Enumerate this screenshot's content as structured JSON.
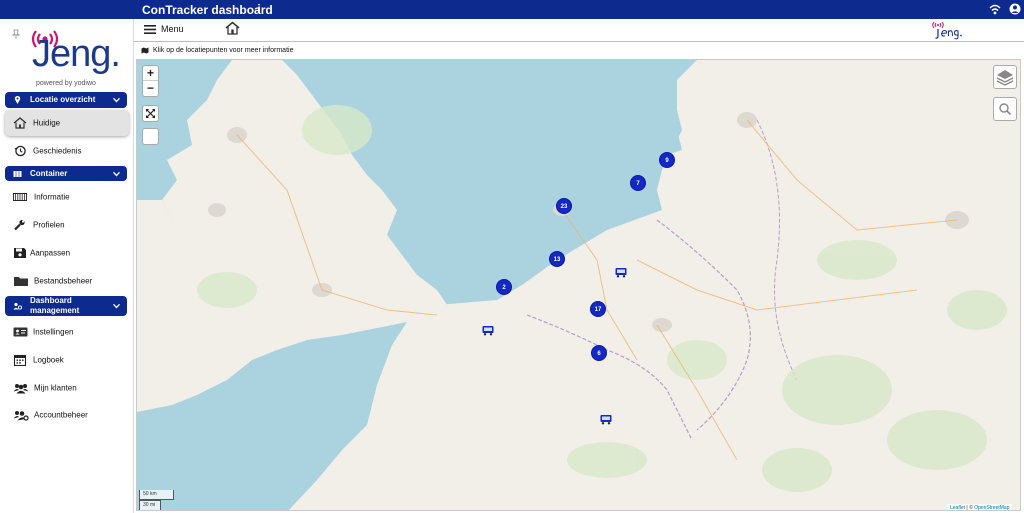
{
  "topbar": {
    "title": "ConTracker dashboard",
    "info_icon": "i"
  },
  "logo": {
    "word": "Jeng.",
    "tagline": "powered by yodiwo"
  },
  "sidebar": {
    "section_location": "Locatie overzicht",
    "items_location": [
      {
        "label": "Huidige",
        "icon": "home-icon",
        "active": true
      },
      {
        "label": "Geschiedenis",
        "icon": "history-icon",
        "active": false
      }
    ],
    "section_container": "Container",
    "items_container": [
      {
        "label": "Informatie",
        "icon": "container-icon"
      },
      {
        "label": "Profielen",
        "icon": "wrench-icon"
      },
      {
        "label": "Aanpassen",
        "icon": "save-icon"
      },
      {
        "label": "Bestandsbeheer",
        "icon": "folder-icon"
      }
    ],
    "section_dashboard": "Dashboard management",
    "items_dashboard": [
      {
        "label": "Instellingen",
        "icon": "id-card-icon"
      },
      {
        "label": "Logboek",
        "icon": "calendar-icon"
      },
      {
        "label": "Mijn klanten",
        "icon": "users-icon"
      },
      {
        "label": "Accountbeheer",
        "icon": "users-cog-icon"
      }
    ]
  },
  "header": {
    "menu_label": "Menu"
  },
  "subheader": {
    "text": "Klik op de locatiepunten voor meer informatie"
  },
  "map": {
    "zoom_in": "+",
    "zoom_out": "−",
    "clusters": [
      {
        "count": "9"
      },
      {
        "count": "7"
      },
      {
        "count": "23"
      },
      {
        "count": "13"
      },
      {
        "count": "2"
      },
      {
        "count": "17"
      },
      {
        "count": "6"
      }
    ],
    "scale_km": "50 km",
    "scale_mi": "30 mi",
    "attribution_leaflet": "Leaflet",
    "attribution_sep": " | © ",
    "attribution_osm": "OpenStreetMap"
  },
  "colors": {
    "brand": "#0d2a8e",
    "cluster": "#1428c6",
    "sea": "#aad3df",
    "land": "#f2efe9"
  }
}
